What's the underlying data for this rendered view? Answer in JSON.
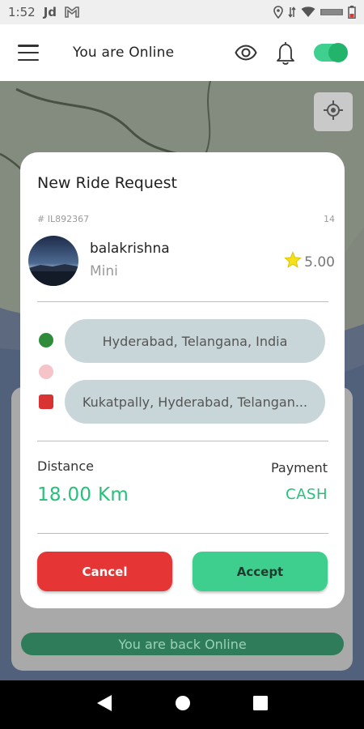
{
  "status_bar": {
    "time": "1:52",
    "carrier": "Jd",
    "icons": [
      "gmail-icon",
      "location-icon",
      "data-icon",
      "wifi-icon",
      "signal-icon",
      "battery-icon"
    ]
  },
  "app_bar": {
    "title": "You are Online",
    "menu_icon": "menu-icon",
    "eye_icon": "eye-icon",
    "bell_icon": "bell-icon",
    "online_toggle": true
  },
  "map": {
    "locate_icon": "my-location-icon"
  },
  "modal": {
    "title": "New Ride Request",
    "ride_id": "# IL892367",
    "count": "14",
    "rider": {
      "name": "balakrishna",
      "vehicle_type": "Mini",
      "rating": "5.00"
    },
    "pickup": "Hyderabad, Telangana, India",
    "dropoff": "Kukatpally, Hyderabad, Telangan...",
    "distance_label": "Distance",
    "distance_value": "18.00  Km",
    "payment_label": "Payment",
    "payment_value": "CASH",
    "cancel_label": "Cancel",
    "accept_label": "Accept"
  },
  "background": {
    "back_online": "You are back Online"
  },
  "colors": {
    "accent_green": "#27c07a",
    "cancel_red": "#e63535",
    "accept_green": "#3ecf8e"
  }
}
